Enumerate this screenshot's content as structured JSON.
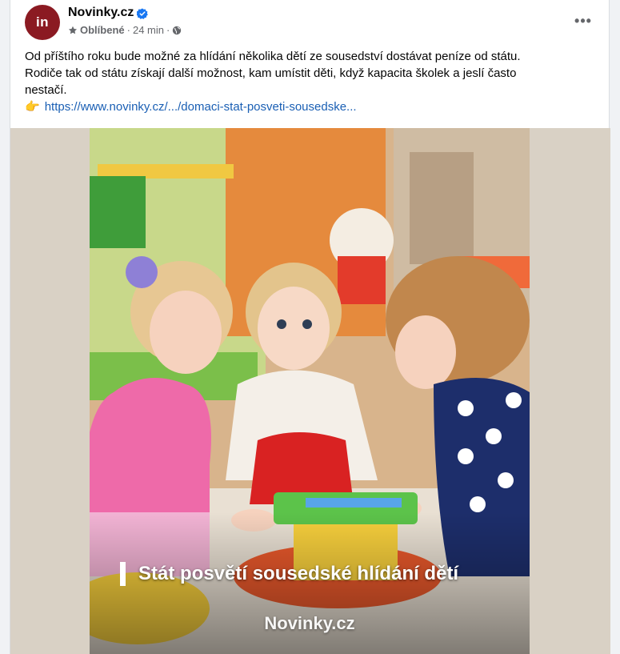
{
  "post": {
    "avatar_text": "in",
    "page_name": "Novinky.cz",
    "meta": {
      "favorites_label": "Oblíbené",
      "separator": "·",
      "time": "24 min",
      "separator2": "·"
    },
    "more_label": "•••",
    "text_lines": [
      "Od příštího roku bude možné za hlídání několika dětí ze sousedství dostávat peníze od státu.",
      "Rodiče tak od státu získají další možnost, kam umístit děti, když kapacita školek a jeslí často",
      "nestačí."
    ],
    "link_emoji": "👉",
    "link_text": "https://www.novinky.cz/.../domaci-stat-posveti-sousedske...",
    "image": {
      "caption": "Stát posvětí sousedské hlídání dětí",
      "brand": "Novinky.cz"
    }
  },
  "colors": {
    "avatar_bg": "#8b1a22",
    "verified": "#1877f2",
    "link": "#1a5fb4"
  }
}
